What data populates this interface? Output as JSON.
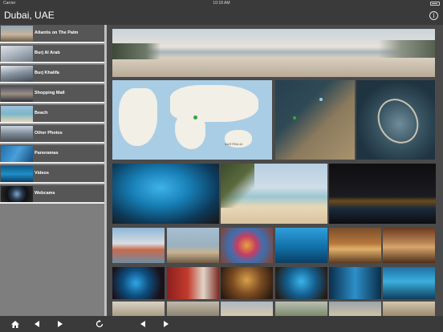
{
  "status": {
    "carrier": "Carrier",
    "time": "10:18 AM"
  },
  "header": {
    "title": "Dubai, UAE",
    "info_icon": "info-icon"
  },
  "sidebar": {
    "items": [
      {
        "label": "Atlantis on The Palm"
      },
      {
        "label": "Burj Al Arab"
      },
      {
        "label": "Burj Khalifa"
      },
      {
        "label": "Shopping Mall"
      },
      {
        "label": "Beach"
      },
      {
        "label": "Other Photos"
      },
      {
        "label": "Panoramas"
      },
      {
        "label": "Videos"
      },
      {
        "label": "Webcams"
      }
    ]
  },
  "maps": {
    "world_label": "AUSTRALIA"
  },
  "toolbar": {
    "home": "home-icon",
    "back": "back-arrow-icon",
    "forward": "forward-arrow-icon",
    "refresh": "refresh-icon",
    "page_back": "page-back-icon",
    "page_forward": "page-forward-icon"
  },
  "colors": {
    "bar": "#3a3a3a",
    "sidebar_bg": "#7e7e7e",
    "menu_item": "#565656",
    "separator": "#ececec",
    "gallery_bg": "#4a4a4a"
  }
}
